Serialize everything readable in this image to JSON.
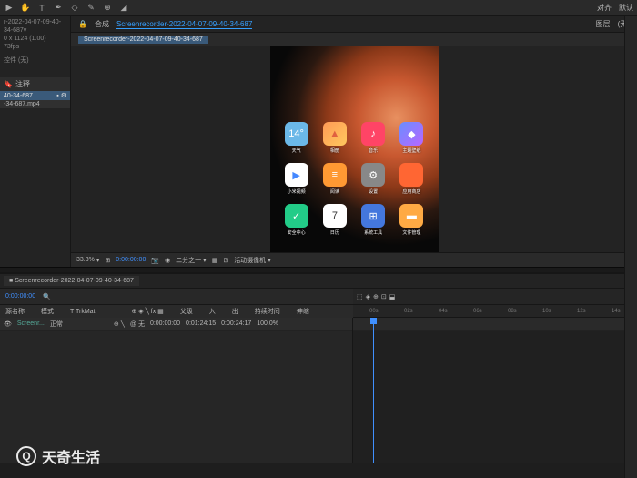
{
  "toolbar": {
    "align_label": "对齐",
    "default_label": "默认"
  },
  "project": {
    "name": "r-2022-04-07-09-40-34-687v",
    "dims": "0 x 1124 (1.00)",
    "fps": "73fps",
    "assets_label": "控件 (无)",
    "annotation_label": "注释",
    "asset1": "40-34-687",
    "asset2": "-34-687.mp4"
  },
  "viewer": {
    "tab1": "合成",
    "tab1_name": "Screenrecorder-2022-04-07-09-40-34-687",
    "tab2": "图层",
    "tab2_val": "(无)",
    "subtab": "Screenrecorder-2022-04-07-09-40-34-687",
    "zoom": "33.3%",
    "time": "0:00:00:00",
    "quality": "二分之一",
    "camera": "活动摄像机"
  },
  "apps": {
    "r1": [
      {
        "label": "天气",
        "text": "14°",
        "bg": "#6bb8e8"
      },
      {
        "label": "相册",
        "text": "▲",
        "bg": "linear-gradient(135deg,#ff9a56,#ffc85e)"
      },
      {
        "label": "音乐",
        "text": "♪",
        "bg": "#ff4466"
      },
      {
        "label": "主题壁纸",
        "text": "◆",
        "bg": "linear-gradient(135deg,#6a8eff,#b866ff)"
      }
    ],
    "r2": [
      {
        "label": "小米视频",
        "text": "▶",
        "bg": "#ffffff"
      },
      {
        "label": "阅读",
        "text": "≡",
        "bg": "#ff9933"
      },
      {
        "label": "设置",
        "text": "⚙",
        "bg": "#888888"
      },
      {
        "label": "应用商店",
        "text": "",
        "bg": "#ff6633"
      }
    ],
    "r3": [
      {
        "label": "安全中心",
        "text": "✓",
        "bg": "#22cc88"
      },
      {
        "label": "日历",
        "text": "7",
        "bg": "#ffffff"
      },
      {
        "label": "系统工具",
        "text": "⊞",
        "bg": "#4477dd"
      },
      {
        "label": "文件管理",
        "text": "▬",
        "bg": "#ffaa44"
      }
    ]
  },
  "timeline": {
    "tab": "Screenrecorder-2022-04-07-09-40-34-687",
    "timecode": "0:00:00:00",
    "cols": {
      "source": "源名称",
      "mode": "模式",
      "trkmat": "T TrkMat",
      "parent": "父级",
      "in": "入",
      "out": "出",
      "duration": "持续时间",
      "stretch": "伸缩"
    },
    "layer1": {
      "name": "Screenr...",
      "mode": "正常",
      "parent": "无",
      "in": "0:00:00:00",
      "out": "0:01:24:15",
      "dur": "0:00:24:17",
      "stretch": "100.0%"
    },
    "ticks": [
      "00s",
      "02s",
      "04s",
      "06s",
      "08s",
      "10s",
      "12s",
      "14s"
    ]
  },
  "watermark": "天奇生活"
}
